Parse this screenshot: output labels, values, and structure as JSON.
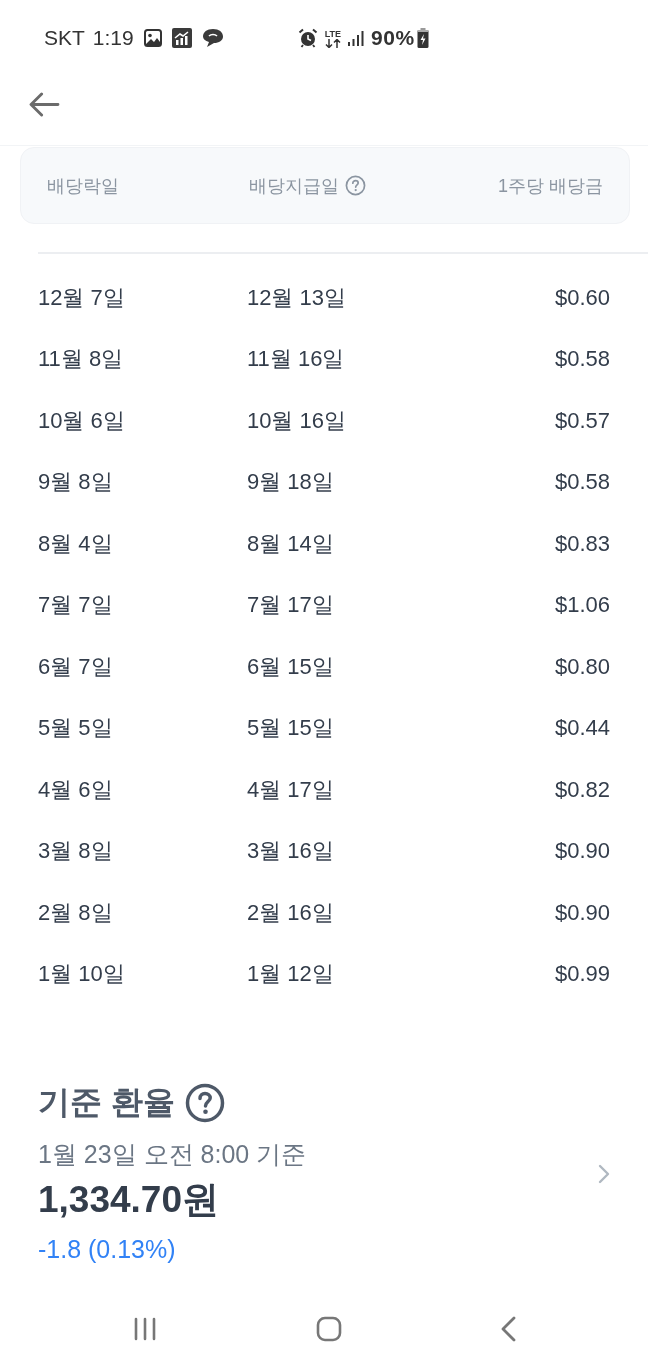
{
  "status_bar": {
    "carrier": "SKT",
    "time": "1:19",
    "network": "LTE",
    "battery": "90%"
  },
  "table": {
    "columns": [
      {
        "label": "배당락일",
        "kind": "plain"
      },
      {
        "label": "배당지급일",
        "kind": "help"
      },
      {
        "label": "1주당 배당금",
        "kind": "plain"
      }
    ],
    "rows": [
      {
        "ex_date": "12월 7일",
        "pay_date": "12월 13일",
        "amount": "$0.60"
      },
      {
        "ex_date": "11월 8일",
        "pay_date": "11월 16일",
        "amount": "$0.58"
      },
      {
        "ex_date": "10월 6일",
        "pay_date": "10월 16일",
        "amount": "$0.57"
      },
      {
        "ex_date": "9월 8일",
        "pay_date": "9월 18일",
        "amount": "$0.58"
      },
      {
        "ex_date": "8월 4일",
        "pay_date": "8월 14일",
        "amount": "$0.83"
      },
      {
        "ex_date": "7월 7일",
        "pay_date": "7월 17일",
        "amount": "$1.06"
      },
      {
        "ex_date": "6월 7일",
        "pay_date": "6월 15일",
        "amount": "$0.80"
      },
      {
        "ex_date": "5월 5일",
        "pay_date": "5월 15일",
        "amount": "$0.44"
      },
      {
        "ex_date": "4월 6일",
        "pay_date": "4월 17일",
        "amount": "$0.82"
      },
      {
        "ex_date": "3월 8일",
        "pay_date": "3월 16일",
        "amount": "$0.90"
      },
      {
        "ex_date": "2월 8일",
        "pay_date": "2월 16일",
        "amount": "$0.90"
      },
      {
        "ex_date": "1월 10일",
        "pay_date": "1월 12일",
        "amount": "$0.99"
      }
    ]
  },
  "exchange_rate": {
    "title": "기준 환율",
    "timestamp": "1월 23일 오전 8:00 기준",
    "value": "1,334.70원",
    "change": "-1.8 (0.13%)"
  }
}
